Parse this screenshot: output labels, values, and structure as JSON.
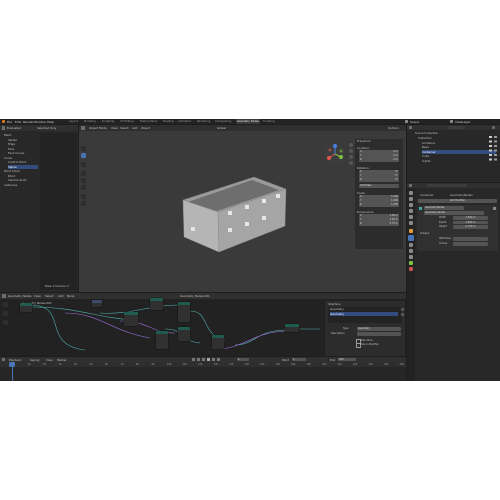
{
  "menubar": {
    "menus": [
      "File",
      "Edit",
      "Render",
      "Window",
      "Help"
    ],
    "workspaces": [
      "Layout",
      "Modeling",
      "Sculpting",
      "UV Editing",
      "Texture Paint",
      "Shading",
      "Animation",
      "Rendering",
      "Compositing",
      "Geometry Nodes",
      "Scripting"
    ],
    "active_workspace": "Geometry Nodes",
    "scene": "Scene",
    "view_layer": "ViewLayer"
  },
  "spreadsheet": {
    "editor": "Evaluated",
    "filter": "Selected Only",
    "items": [
      "Mesh",
      "Vertex",
      "Edge",
      "Face",
      "Face Corner",
      "Curve",
      "Control Point",
      "Spline",
      "Point Cloud",
      "Point",
      "Volume Grids",
      "Instances"
    ],
    "selected_index": 10,
    "footer": "Rows: 0   Columns: 0"
  },
  "viewport": {
    "mode": "Object Mode",
    "menus": [
      "View",
      "Select",
      "Add",
      "Object"
    ],
    "orientation": "Global",
    "options": "Options",
    "transform_panel": {
      "title": "Transform",
      "location_label": "Location:",
      "location": [
        "0 m",
        "0 m",
        "0 m"
      ],
      "rotation_label": "Rotation:",
      "rotation": [
        "0°",
        "0°",
        "0°"
      ],
      "mode": "XYZ Euler",
      "scale_label": "Scale:",
      "scale": [
        "1.000",
        "1.000",
        "1.000"
      ],
      "dimensions_label": "Dimensions:",
      "dimensions": [
        "1.56 m",
        "1.10 m",
        "0.73 m"
      ],
      "axes": [
        "X",
        "Y",
        "Z"
      ]
    }
  },
  "node_editor": {
    "editor": "Geometry Nodes",
    "menus": [
      "View",
      "Select",
      "Add",
      "Node"
    ],
    "tree_name": "Geometry Nodes.001",
    "breadcrumb": "Geometry Nodes.001",
    "interface_panel": {
      "title": "Interface",
      "items": [
        "Geometry",
        "Geometry"
      ],
      "type_label": "Type",
      "type_value": "Geometry",
      "description_label": "Description",
      "option1": "Hide Value",
      "option2": "Hide in Modifier"
    }
  },
  "timeline": {
    "menus": [
      "Playback",
      "Keying",
      "View",
      "Marker"
    ],
    "current_frame": "1",
    "start_label": "Start",
    "start": "1",
    "end_label": "End",
    "end": "250",
    "ticks": [
      "0",
      "10",
      "20",
      "30",
      "40",
      "50",
      "60",
      "70",
      "80",
      "90",
      "100",
      "110",
      "120",
      "130",
      "140",
      "150",
      "160",
      "170",
      "180",
      "190",
      "200",
      "210",
      "220",
      "230",
      "240",
      "250"
    ]
  },
  "outliner": {
    "title": "Scene Collection",
    "items": [
      "Collection",
      "Armature",
      "Base",
      "Container",
      "Cube",
      "Lights"
    ]
  },
  "properties": {
    "object_name": "Container",
    "modifier_tab": "GeometryNodes",
    "add_modifier": "Add Modifier",
    "modifier_name": "GeometryNodes",
    "node_group": "Geometry Nodes",
    "inputs": [
      {
        "label": "Width",
        "value": "1.500 m"
      },
      {
        "label": "Depth",
        "value": "1.000 m"
      },
      {
        "label": "Height",
        "value": "0.700 m"
      }
    ],
    "output_label": "Output",
    "outputs": [
      {
        "label": "Attributes",
        "value": ""
      },
      {
        "label": "Indices",
        "value": ""
      }
    ]
  },
  "colors": {
    "accent": "#4772b3",
    "node_header_green": "#1f5b4e",
    "link_teal": "#4fb3b0",
    "link_purple": "#9b6fd6",
    "panel_bg": "#282828",
    "background": "#1d1d1d",
    "viewport_bg": "#3a3a3a"
  }
}
